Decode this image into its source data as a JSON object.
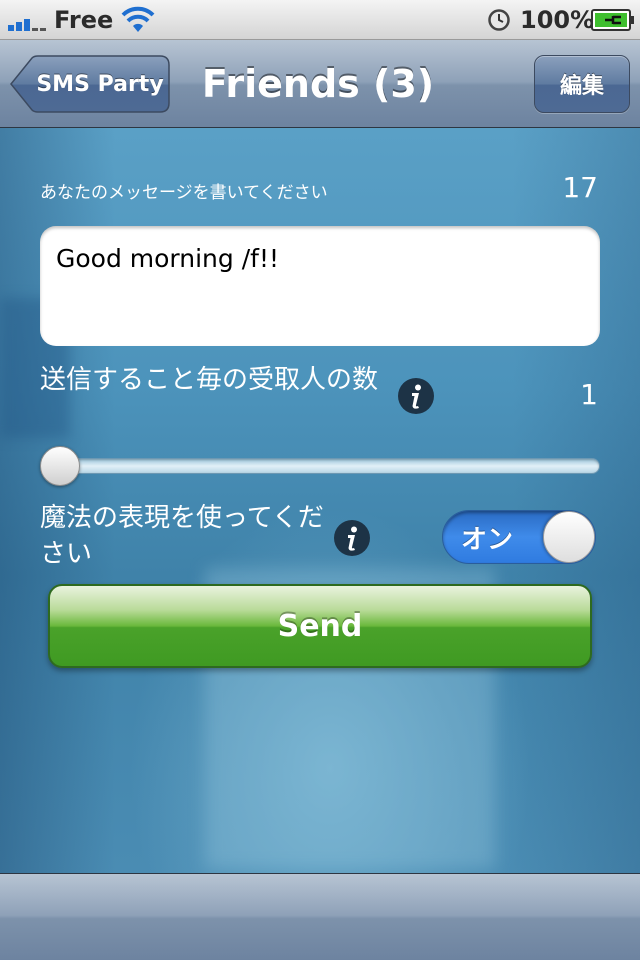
{
  "status_bar": {
    "carrier": "Free",
    "battery_percent": "100%",
    "signal_bars": 3
  },
  "nav_bar": {
    "back_label": "SMS Party",
    "title": "Friends (3)",
    "edit_label": "編集"
  },
  "form": {
    "message_label": "あなたのメッセージを書いてください",
    "char_count": "17",
    "message_value": "Good morning /f!!",
    "recipients_label": "送信すること毎の受取人の数",
    "recipients_count": "1",
    "recipients_slider_fraction": 0.0,
    "magic_label": "魔法の表現を使ってください",
    "magic_toggle_label": "オン",
    "magic_toggle_on": true,
    "send_label": "Send"
  },
  "colors": {
    "nav_bar": "#8ea1b8",
    "toggle_on": "#3f8bea",
    "send_button": "#4aa22a",
    "content_background": "#4c93bb"
  },
  "icons": [
    "signal-icon",
    "wifi-icon",
    "clock-icon",
    "battery-charging-icon",
    "back-arrow-icon",
    "info-icon"
  ]
}
